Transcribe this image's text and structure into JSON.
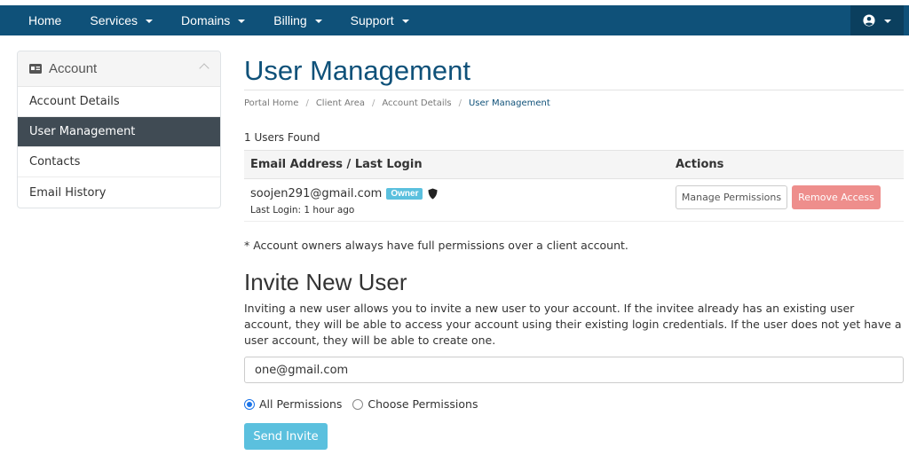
{
  "nav": {
    "items": [
      {
        "label": "Home",
        "dropdown": false
      },
      {
        "label": "Services",
        "dropdown": true
      },
      {
        "label": "Domains",
        "dropdown": true
      },
      {
        "label": "Billing",
        "dropdown": true
      },
      {
        "label": "Support",
        "dropdown": true
      }
    ],
    "user_icon": "user-circle-icon"
  },
  "sidebar": {
    "title": "Account",
    "title_icon": "id-card-icon",
    "items": [
      {
        "label": "Account Details",
        "active": false
      },
      {
        "label": "User Management",
        "active": true
      },
      {
        "label": "Contacts",
        "active": false
      },
      {
        "label": "Email History",
        "active": false
      }
    ]
  },
  "main": {
    "title": "User Management",
    "breadcrumb": [
      "Portal Home",
      "Client Area",
      "Account Details",
      "User Management"
    ],
    "users_found": "1 Users Found",
    "table": {
      "headers": [
        "Email Address / Last Login",
        "Actions"
      ],
      "rows": [
        {
          "email": "soojen291@gmail.com",
          "badge": "Owner",
          "last_login": "Last Login: 1 hour ago",
          "manage_label": "Manage Permissions",
          "remove_label": "Remove Access"
        }
      ]
    },
    "note": "* Account owners always have full permissions over a client account."
  },
  "invite": {
    "title": "Invite New User",
    "description": "Inviting a new user allows you to invite a new user to your account. If the invitee already has an existing user account, they will be able to access your account using their existing login credentials. If the user does not yet have a user account, they will be able to create one.",
    "email_value": "one@gmail.com",
    "options": [
      {
        "label": "All Permissions",
        "checked": true
      },
      {
        "label": "Choose Permissions",
        "checked": false
      }
    ],
    "send_label": "Send Invite"
  },
  "colors": {
    "nav_bg": "#0f5179",
    "accent": "#5bc0de",
    "active_item_bg": "#404b54",
    "danger": "#ee8e8c"
  }
}
